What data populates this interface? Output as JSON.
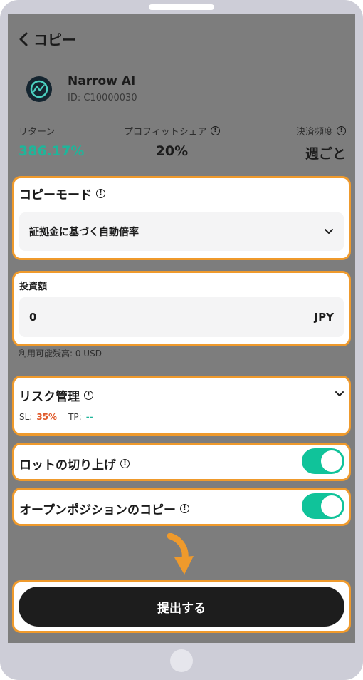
{
  "header": {
    "title": "コピー"
  },
  "trader": {
    "name": "Narrow AI",
    "id": "ID: C10000030"
  },
  "stats": [
    {
      "label": "リターン",
      "value": "386.17%"
    },
    {
      "label": "プロフィットシェア",
      "value": "20%"
    },
    {
      "label": "決済頻度",
      "value": "週ごと"
    }
  ],
  "copy_mode": {
    "title": "コピーモード",
    "selected": "証拠金に基づく自動倍率"
  },
  "investment": {
    "title": "投資額",
    "value": "0",
    "currency": "JPY",
    "available": "利用可能残高: 0 USD"
  },
  "risk": {
    "title": "リスク管理",
    "sl_label": "SL:",
    "sl_value": "35%",
    "tp_label": "TP:",
    "tp_value": "--"
  },
  "round_up_lots": {
    "label": "ロットの切り上げ",
    "enabled": true
  },
  "copy_open_positions": {
    "label": "オープンポジションのコピー",
    "enabled": true
  },
  "submit": {
    "label": "提出する"
  },
  "colors": {
    "highlight": "#ef9a2c",
    "positive": "#1fb59a",
    "negative": "#e05a2b",
    "toggle_on": "#10c39a",
    "button": "#1d1d1d"
  },
  "icons": [
    "chevron-left-icon",
    "info-icon",
    "chevron-down-icon",
    "arrow-down-icon",
    "trader-avatar-icon"
  ]
}
